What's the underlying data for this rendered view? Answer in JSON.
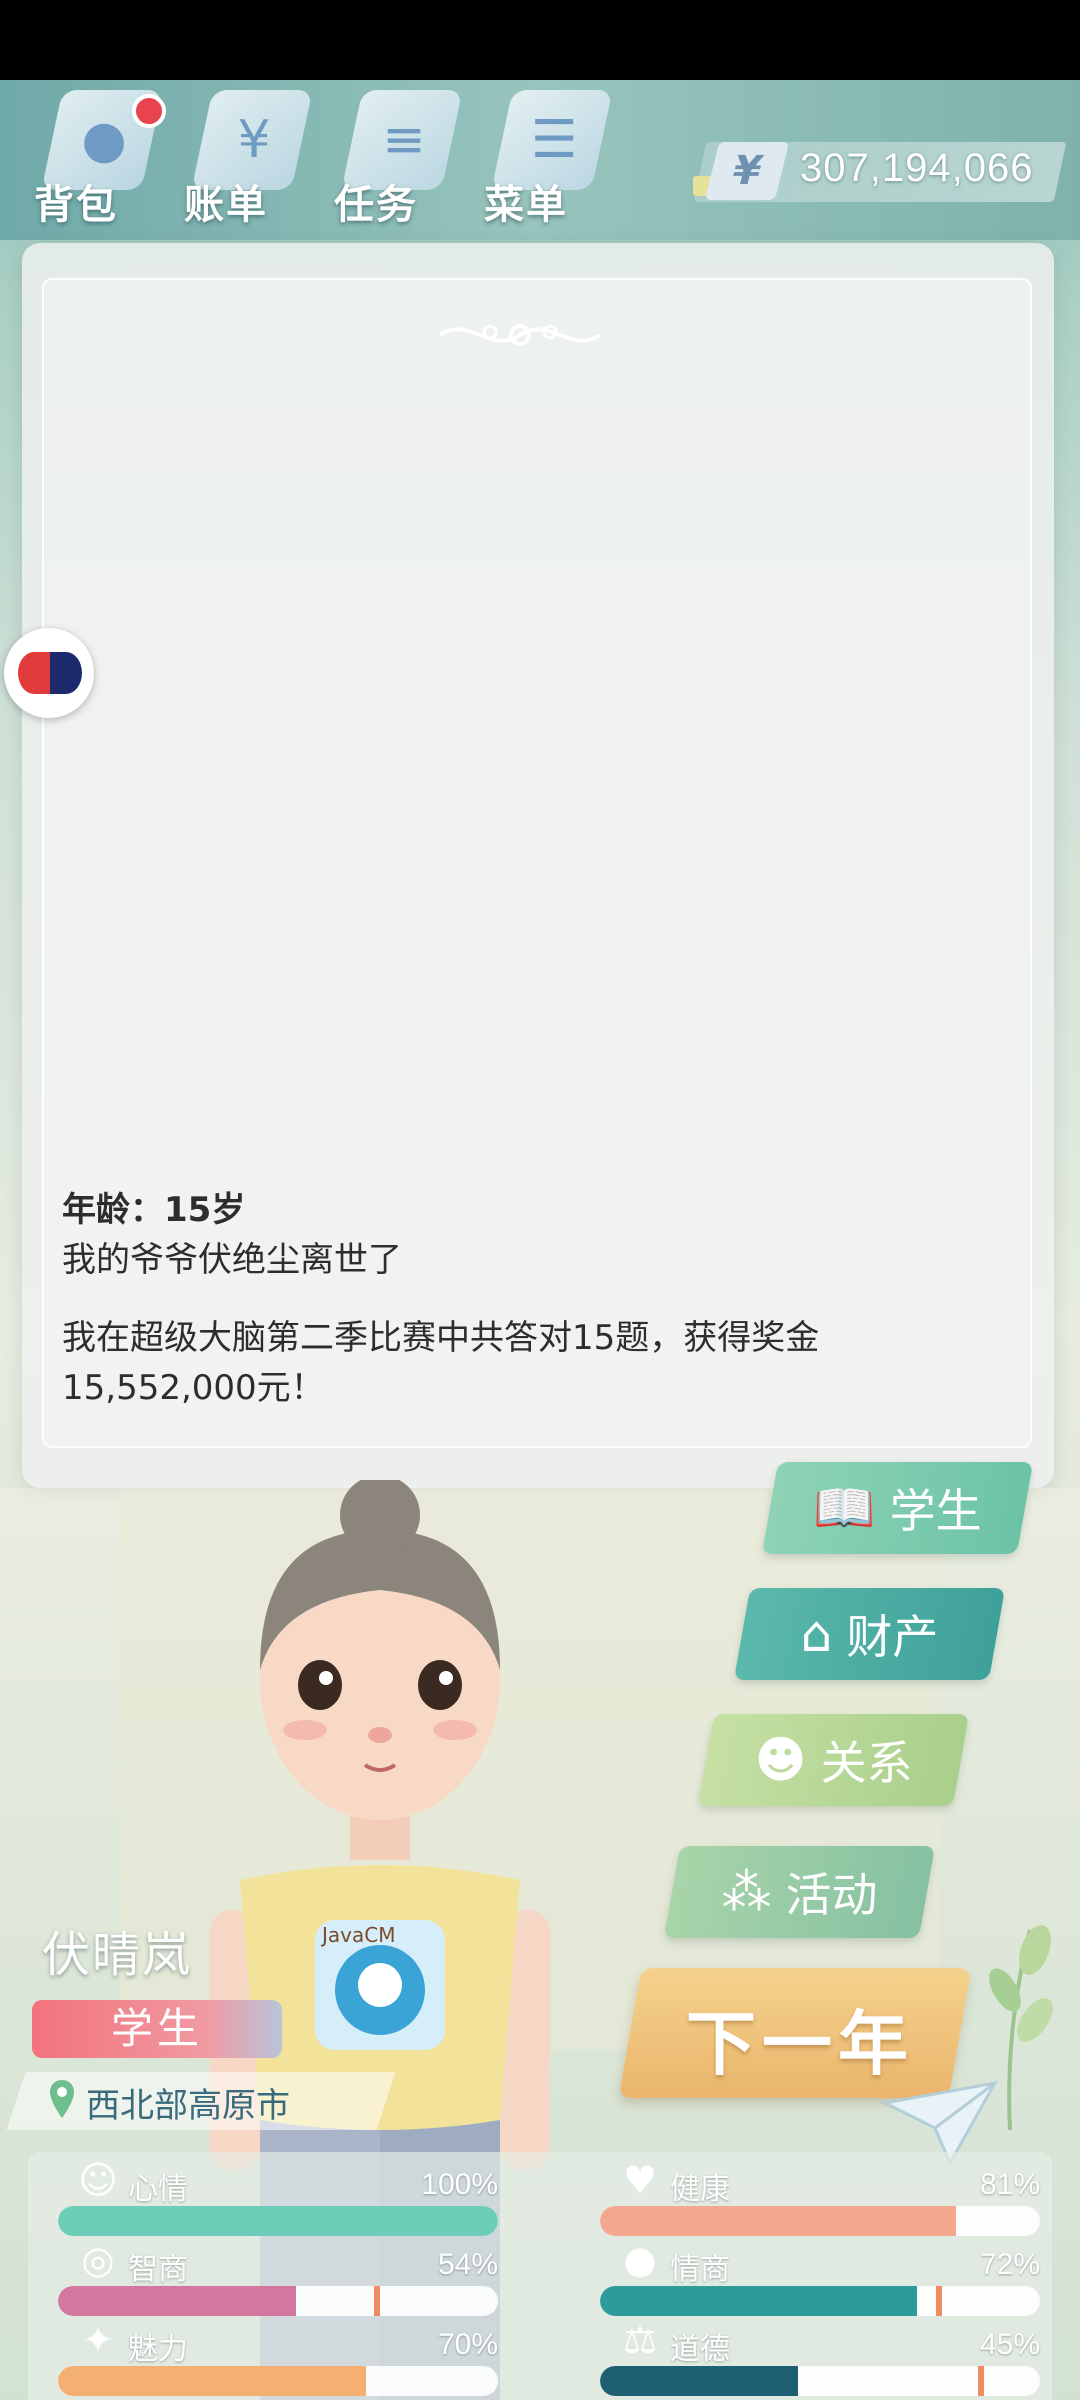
{
  "topbar": {
    "buttons": [
      {
        "label": "背包",
        "icon": "bag-icon",
        "badge": true
      },
      {
        "label": "账单",
        "icon": "bill-icon",
        "badge": false
      },
      {
        "label": "任务",
        "icon": "task-icon",
        "badge": false
      },
      {
        "label": "菜单",
        "icon": "menu-icon",
        "badge": false
      }
    ],
    "currency_symbol": "¥",
    "money": "307,194,066"
  },
  "event": {
    "age_line": "年龄：15岁",
    "line1": "我的爷爷伏绝尘离世了",
    "line2": "我在超级大脑第二季比赛中共答对15题，获得奖金15,552,000元！"
  },
  "character": {
    "name": "伏晴岚",
    "occupation": "学生",
    "location": "西北部高原市",
    "shirt_text": "JavaCM"
  },
  "menu": {
    "student": "学生",
    "property": "财产",
    "relation": "关系",
    "activity": "活动",
    "next_year": "下一年"
  },
  "stats": [
    {
      "name": "心情",
      "value": "100%",
      "level": 100,
      "color": "#6ccdb8",
      "icon": "smile-icon"
    },
    {
      "name": "健康",
      "value": "81%",
      "level": 81,
      "color": "#f5a88f",
      "icon": "heart-icon"
    },
    {
      "name": "智商",
      "value": "54%",
      "level": 54,
      "color": "#d377a0",
      "icon": "bulb-icon"
    },
    {
      "name": "情商",
      "value": "72%",
      "level": 72,
      "color": "#2e9a9a",
      "icon": "apple-icon"
    },
    {
      "name": "魅力",
      "value": "70%",
      "level": 70,
      "color": "#f4b073",
      "icon": "sparkle-icon"
    },
    {
      "name": "道德",
      "value": "45%",
      "level": 45,
      "color": "#1e5f73",
      "icon": "scale-icon"
    }
  ]
}
